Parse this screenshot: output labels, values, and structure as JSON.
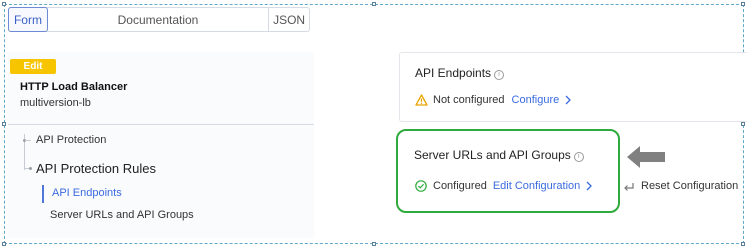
{
  "tabs": [
    {
      "label": "Form",
      "active": true
    },
    {
      "label": "Documentation",
      "active": false
    },
    {
      "label": "JSON",
      "active": false
    }
  ],
  "left": {
    "badge": "Edit",
    "title": "HTTP Load Balancer",
    "name": "multiversion-lb",
    "nav": {
      "api_protection": "API Protection",
      "api_protection_rules": "API Protection Rules",
      "api_endpoints": "API Endpoints",
      "server_urls": "Server URLs and API Groups"
    }
  },
  "card_endpoints": {
    "title": "API Endpoints",
    "status": "Not configured",
    "action": "Configure"
  },
  "card_server": {
    "title": "Server URLs and API Groups",
    "status": "Configured",
    "action": "Edit Configuration",
    "reset": "Reset Configuration"
  },
  "colors": {
    "accent": "#3b6be0",
    "badge": "#f7c400",
    "highlight": "#2faa3c",
    "warning": "#e8a400"
  }
}
